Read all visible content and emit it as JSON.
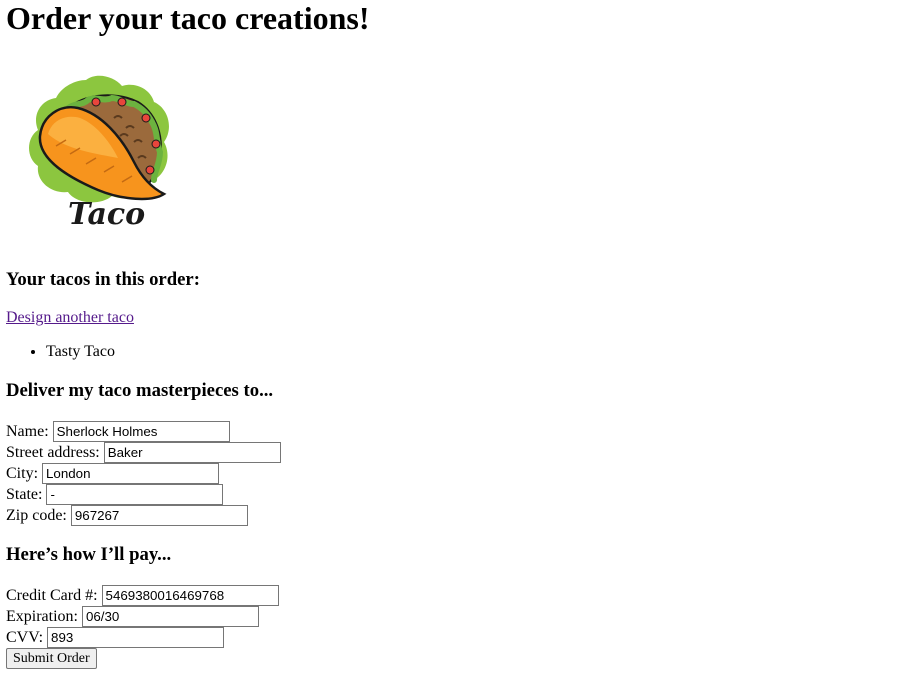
{
  "page": {
    "title": "Order your taco creations!"
  },
  "logo": {
    "icon": "taco-logo-icon",
    "text": "Taco",
    "colors": {
      "splash": "#8cc63f",
      "shell": "#f7941d",
      "shell_light": "#fbb040",
      "filling": "#9b6a3c",
      "lettuce": "#6cb33f",
      "tomato": "#e8453c",
      "outline": "#1a1a1a"
    }
  },
  "order": {
    "heading": "Your tacos in this order:",
    "design_link": "Design another taco",
    "tacos": [
      "Tasty Taco"
    ]
  },
  "delivery": {
    "heading": "Deliver my taco masterpieces to...",
    "fields": {
      "name": {
        "label": "Name:",
        "value": "Sherlock Holmes"
      },
      "street": {
        "label": "Street address:",
        "value": "Baker"
      },
      "city": {
        "label": "City:",
        "value": "London"
      },
      "state": {
        "label": "State:",
        "value": "-"
      },
      "zip": {
        "label": "Zip code:",
        "value": "967267"
      }
    }
  },
  "payment": {
    "heading": "Here’s how I’ll pay...",
    "fields": {
      "cc": {
        "label": "Credit Card #:",
        "value": "5469380016469768"
      },
      "expiration": {
        "label": "Expiration:",
        "value": "06/30"
      },
      "cvv": {
        "label": "CVV:",
        "value": "893"
      }
    }
  },
  "submit": {
    "label": "Submit Order"
  }
}
